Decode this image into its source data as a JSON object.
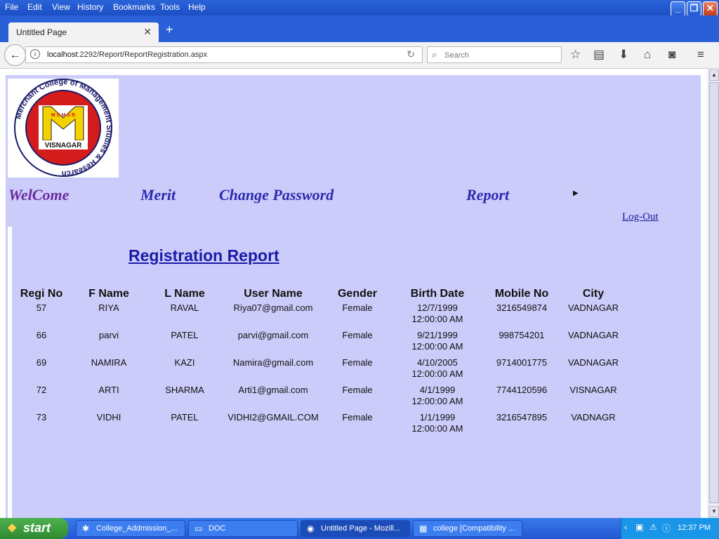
{
  "menu": {
    "items": [
      "File",
      "Edit",
      "View",
      "History",
      "Bookmarks",
      "Tools",
      "Help"
    ]
  },
  "window_buttons": {
    "minimize": "_",
    "restore": "❐",
    "close": "✕"
  },
  "tab": {
    "title": "Untitled Page",
    "close": "✕",
    "new_tab": "+"
  },
  "toolbar": {
    "url_host": "localhost",
    "url_rest": ":2292/Report/ReportRegistration.aspx",
    "search_placeholder": "Search"
  },
  "logo": {
    "ring_text": "Merchant College of Management Studies & Research",
    "letters": "MCMSR",
    "city": "VISNAGAR"
  },
  "nav": {
    "welcome": "WelCome",
    "merit": "Merit",
    "change_password": "Change Password",
    "report": "Report",
    "logout": "Log-Out"
  },
  "report": {
    "title": "Registration Report",
    "columns": [
      "Regi No",
      "F Name",
      "L Name",
      "User Name",
      "Gender",
      "Birth Date",
      "Mobile No",
      "City"
    ],
    "rows": [
      [
        "57",
        "RIYA",
        "RAVAL",
        "Riya07@gmail.com",
        "Female",
        "12/7/1999 12:00:00 AM",
        "3216549874",
        "VADNAGAR"
      ],
      [
        "66",
        "parvi",
        "PATEL",
        "parvi@gmail.com",
        "Female",
        "9/21/1999 12:00:00 AM",
        "998754201",
        "VADNAGAR"
      ],
      [
        "69",
        "NAMIRA",
        "KAZI",
        "Namira@gmail.com",
        "Female",
        "4/10/2005 12:00:00 AM",
        "9714001775",
        "VADNAGAR"
      ],
      [
        "72",
        "ARTI",
        "SHARMA",
        "Arti1@gmail.com",
        "Female",
        "4/1/1999 12:00:00 AM",
        "7744120596",
        "VISNAGAR"
      ],
      [
        "73",
        "VIDHI",
        "PATEL",
        "VIDHI2@GMAIL.COM",
        "Female",
        "1/1/1999 12:00:00 AM",
        "3216547895",
        "VADNAGR"
      ]
    ]
  },
  "taskbar": {
    "start": "start",
    "tasks": [
      "College_Addmission_...",
      "DOC",
      "Untitled Page - Mozill...",
      "college [Compatibility ..."
    ],
    "clock": "12:37 PM"
  },
  "colors": {
    "page_bg": "#ccccfa",
    "title": "#1a1aa8",
    "nav": "#2a2ab0",
    "welcome": "#6a2aa0"
  }
}
